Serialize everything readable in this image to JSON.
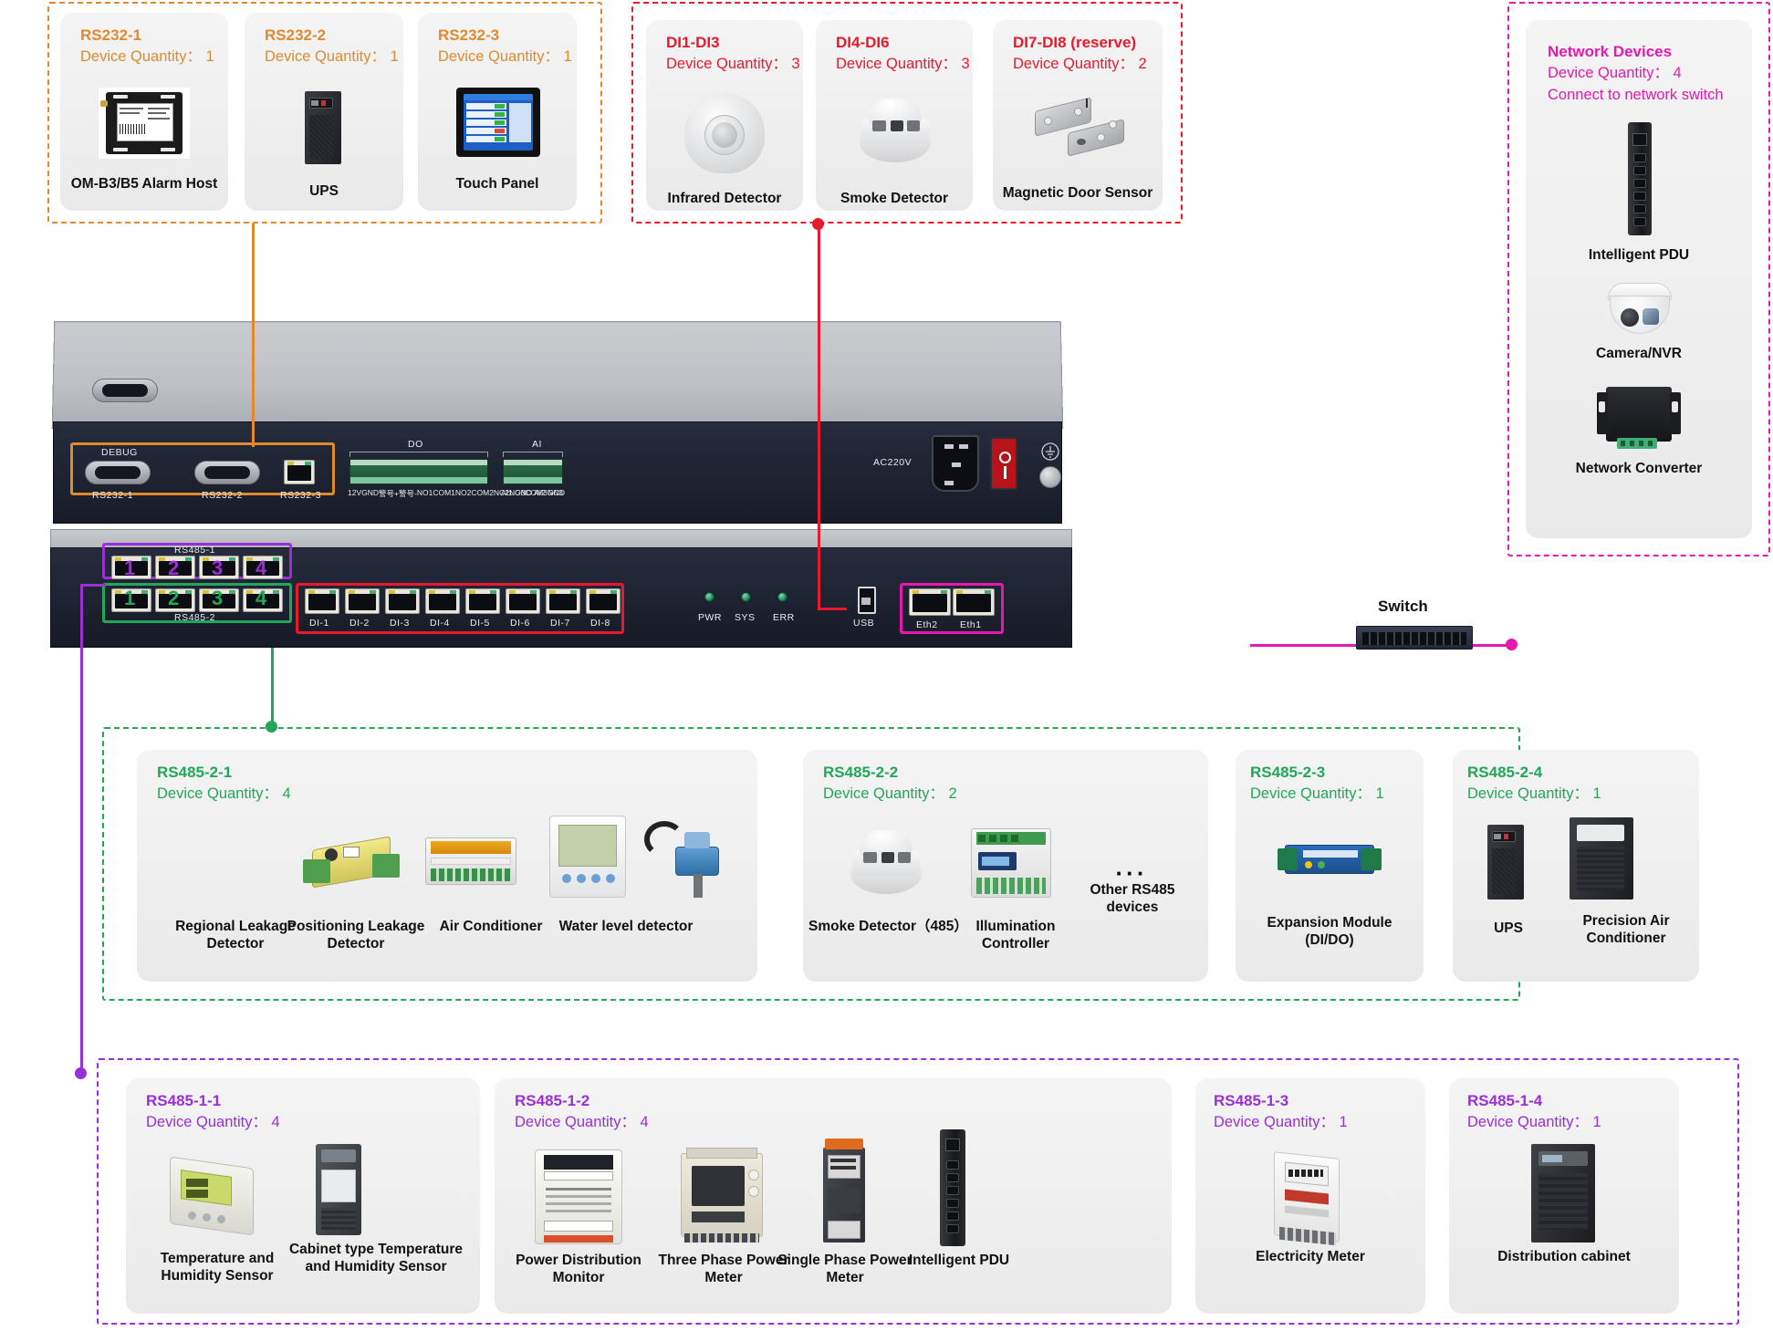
{
  "meta": {
    "qty_label": "Device Quantity：",
    "switch_label": "Switch"
  },
  "groups": {
    "rs232": {
      "color": "#E08A2E",
      "cards": [
        {
          "id": "rs232-1",
          "title": "RS232-1",
          "qty": "Device Quantity： 1",
          "devices": [
            {
              "name": "OM-B3/B5 Alarm Host",
              "icon": "alarm-host-image"
            }
          ]
        },
        {
          "id": "rs232-2",
          "title": "RS232-2",
          "qty": "Device Quantity： 1",
          "devices": [
            {
              "name": "UPS",
              "icon": "ups-image"
            }
          ]
        },
        {
          "id": "rs232-3",
          "title": "RS232-3",
          "qty": "Device Quantity： 1",
          "devices": [
            {
              "name": "Touch  Panel",
              "icon": "touch-panel-image"
            }
          ]
        }
      ]
    },
    "di": {
      "color": "#E8192C",
      "cards": [
        {
          "id": "di1-di3",
          "title": "DI1-DI3",
          "qty": "Device Quantity： 3",
          "devices": [
            {
              "name": "Infrared Detector",
              "icon": "infrared-detector-image"
            }
          ]
        },
        {
          "id": "di4-di6",
          "title": "DI4-DI6",
          "qty": "Device Quantity： 3",
          "devices": [
            {
              "name": "Smoke Detector",
              "icon": "smoke-detector-image"
            }
          ]
        },
        {
          "id": "di7-di8",
          "title": "DI7-DI8 (reserve)",
          "qty": "Device Quantity： 2",
          "devices": [
            {
              "name": "Magnetic Door Sensor",
              "icon": "magnetic-door-sensor-image"
            }
          ]
        }
      ]
    },
    "network": {
      "color": "#E319B0",
      "card": {
        "id": "network-devices",
        "title": "Network Devices",
        "qty": "Device Quantity： 4",
        "note": "Connect to network switch",
        "devices": [
          {
            "name": "Intelligent PDU",
            "icon": "intelligent-pdu-image"
          },
          {
            "name": "Camera/NVR",
            "icon": "camera-nvr-image"
          },
          {
            "name": "Network Converter",
            "icon": "network-converter-image"
          }
        ]
      }
    },
    "rs485_2": {
      "color": "#22A65A",
      "cards": [
        {
          "id": "rs485-2-1",
          "title": "RS485-2-1",
          "qty": "Device Quantity： 4",
          "devices": [
            {
              "name": "Regional Leakage Detector",
              "icon": "regional-leakage-detector-image"
            },
            {
              "name": "Positioning Leakage Detector",
              "icon": "positioning-leakage-detector-image"
            },
            {
              "name": "Air Conditioner",
              "icon": "air-conditioner-image"
            },
            {
              "name": "Water level detector",
              "icon": "water-level-detector-image"
            }
          ]
        },
        {
          "id": "rs485-2-2",
          "title": "RS485-2-2",
          "qty": "Device Quantity： 2",
          "devices": [
            {
              "name": "Smoke Detector（485）",
              "icon": "smoke-detector-485-image"
            },
            {
              "name": "Illumination Controller",
              "icon": "illumination-controller-image"
            },
            {
              "name": "Other RS485 devices",
              "icon": "ellipsis-icon"
            }
          ]
        },
        {
          "id": "rs485-2-3",
          "title": "RS485-2-3",
          "qty": "Device Quantity： 1",
          "devices": [
            {
              "name": "Expansion Module (DI/DO)",
              "icon": "expansion-module-image"
            }
          ]
        },
        {
          "id": "rs485-2-4",
          "title": "RS485-2-4",
          "qty": "Device Quantity： 1",
          "devices": [
            {
              "name": "UPS",
              "icon": "ups-image"
            },
            {
              "name": "Precision Air Conditioner",
              "icon": "precision-air-conditioner-image"
            }
          ]
        }
      ]
    },
    "rs485_1": {
      "color": "#9B2FD6",
      "cards": [
        {
          "id": "rs485-1-1",
          "title": "RS485-1-1",
          "qty": "Device Quantity： 4",
          "devices": [
            {
              "name": "Temperature and Humidity Sensor",
              "icon": "temp-humidity-sensor-image"
            },
            {
              "name": "Cabinet type Temperature and Humidity Sensor",
              "icon": "cabinet-temp-humidity-sensor-image"
            }
          ]
        },
        {
          "id": "rs485-1-2",
          "title": "RS485-1-2",
          "qty": "Device Quantity： 4",
          "devices": [
            {
              "name": "Power Distribution Monitor",
              "icon": "power-distribution-monitor-image"
            },
            {
              "name": "Three Phase Power Meter",
              "icon": "three-phase-power-meter-image"
            },
            {
              "name": "Single Phase Power Meter",
              "icon": "single-phase-power-meter-image"
            },
            {
              "name": "Intelligent PDU",
              "icon": "intelligent-pdu-image"
            }
          ]
        },
        {
          "id": "rs485-1-3",
          "title": "RS485-1-3",
          "qty": "Device Quantity： 1",
          "devices": [
            {
              "name": "Electricity Meter",
              "icon": "electricity-meter-image"
            }
          ]
        },
        {
          "id": "rs485-1-4",
          "title": "RS485-1-4",
          "qty": "Device Quantity： 1",
          "devices": [
            {
              "name": "Distribution cabinet",
              "icon": "distribution-cabinet-image"
            }
          ]
        }
      ]
    }
  },
  "chassis": {
    "rear": {
      "debug_label": "DEBUG",
      "serial_ports": [
        "RS232-1",
        "RS232-2",
        "RS232-3"
      ],
      "do_label": "DO",
      "do_terminals": [
        "12V",
        "GND",
        "警号+",
        "警号-",
        "NO1",
        "COM1",
        "NO2",
        "COM2",
        "NC2",
        "NO3",
        "COM3",
        "NC3"
      ],
      "ai_label": "AI",
      "ai_terminals": [
        "AI1",
        "GND",
        "AI2",
        "GND"
      ],
      "power_label": "AC220V"
    },
    "front": {
      "rs485_1_label": "RS485-1",
      "rs485_1_ports": [
        "1",
        "2",
        "3",
        "4"
      ],
      "rs485_2_label": "RS485-2",
      "rs485_2_ports": [
        "1",
        "2",
        "3",
        "4"
      ],
      "di_ports": [
        "DI-1",
        "DI-2",
        "DI-3",
        "DI-4",
        "DI-5",
        "DI-6",
        "DI-7",
        "DI-8"
      ],
      "leds": [
        "PWR",
        "SYS",
        "ERR"
      ],
      "usb_label": "USB",
      "eth_ports": [
        "Eth2",
        "Eth1"
      ]
    }
  }
}
